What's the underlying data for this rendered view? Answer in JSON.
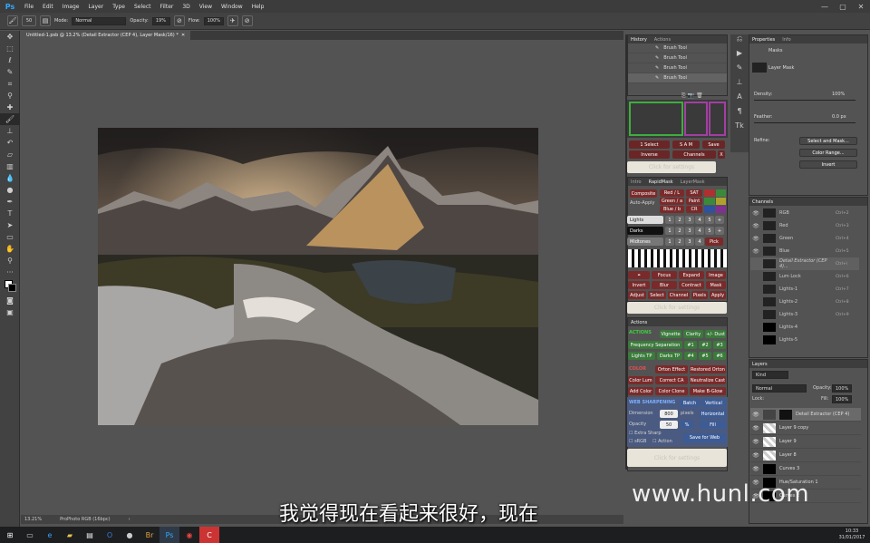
{
  "menubar": {
    "app_icon": "Ps",
    "items": [
      "File",
      "Edit",
      "Image",
      "Layer",
      "Type",
      "Select",
      "Filter",
      "3D",
      "View",
      "Window",
      "Help"
    ],
    "window_controls": [
      "—",
      "▢",
      "✕"
    ]
  },
  "options": {
    "brush_size": "50",
    "mode_label": "Mode:",
    "mode_value": "Normal",
    "opacity_label": "Opacity:",
    "opacity_value": "19%",
    "flow_label": "Flow:",
    "flow_value": "100%"
  },
  "document": {
    "tab_title": "Untitled-1.psb @ 13.2% (Detail Extractor (CEP 4), Layer Mask/16) *",
    "zoom": "13.21%",
    "profile": "ProPhoto RGB (16bpc)"
  },
  "history": {
    "tabs": [
      "History",
      "Actions"
    ],
    "rows": [
      "Brush Tool",
      "Brush Tool",
      "Brush Tool",
      "Brush Tool"
    ]
  },
  "rapidmask": {
    "row1": [
      "1 Select",
      "S A M",
      "Save"
    ],
    "row2": [
      "Inverse",
      "Channels",
      "X"
    ],
    "settings": "Click for settings",
    "tabs": [
      "Intro",
      "RapidMask",
      "LayerMask"
    ],
    "composite": "Composite",
    "auto_apply": "Auto-Apply",
    "rgb": [
      "Red / L",
      "Green / a",
      "Blue / b"
    ],
    "right": [
      "SAT",
      "Paint",
      "CR"
    ],
    "lights": "Lights",
    "darks": "Darks",
    "midtones": "Midtones",
    "nums": [
      "1",
      "2",
      "3",
      "4",
      "5",
      "+"
    ],
    "pick": "Pick",
    "row_a": [
      "Focus",
      "Expand",
      "Image"
    ],
    "row_b": [
      "Invert",
      "Blur",
      "Contract",
      "Mask"
    ],
    "row_c": [
      "Adjust",
      "Select",
      "Channel",
      "Pixels",
      "Apply"
    ],
    "settings2": "Click for settings"
  },
  "actions_panel": {
    "title": "Actions",
    "actions_label": "ACTIONS",
    "a1": [
      "Vignette",
      "Clarity",
      "+/- Dust"
    ],
    "a2": [
      "Frequency Separation",
      "#1",
      "#2",
      "#3"
    ],
    "a3": [
      "Lights TP",
      "Darks TP",
      "#4",
      "#5",
      "#6"
    ],
    "color_label": "COLOR",
    "c1": [
      "Orton Effect",
      "Restored Orton"
    ],
    "c2": [
      "Color Lum",
      "Correct CA",
      "Neutralize Cast"
    ],
    "c3": [
      "Add Color",
      "Color Clone",
      "Make B-Glow"
    ],
    "web_label": "WEB SHARPENING",
    "w_batch": "Batch",
    "w_vertical": "Vertical",
    "dimension": "Dimension",
    "dim_val": "800",
    "pixels": "pixels",
    "horizontal": "Horizontal",
    "opacity": "Opacity",
    "op_val": "50",
    "pct": "%",
    "fill": "Fill",
    "extra_sharp": "Extra Sharp",
    "srgb": "sRGB",
    "action": "Action",
    "save_web": "Save for Web",
    "settings3": "Click for settings"
  },
  "properties": {
    "tabs": [
      "Properties",
      "Info"
    ],
    "masks": "Masks",
    "layer_mask": "Layer Mask",
    "density_label": "Density:",
    "density_value": "100%",
    "feather_label": "Feather:",
    "feather_value": "0.0 px",
    "refine_label": "Refine:",
    "btn_select_mask": "Select and Mask...",
    "btn_color_range": "Color Range...",
    "btn_invert": "Invert"
  },
  "channels": {
    "title": "Channels",
    "rows": [
      {
        "name": "RGB",
        "key": "Ctrl+2"
      },
      {
        "name": "Red",
        "key": "Ctrl+3"
      },
      {
        "name": "Green",
        "key": "Ctrl+4"
      },
      {
        "name": "Blue",
        "key": "Ctrl+5"
      },
      {
        "name": "Detail Extractor (CEP 4)...",
        "key": "Ctrl+\\"
      },
      {
        "name": "Lum Lock",
        "key": "Ctrl+6"
      },
      {
        "name": "Lights-1",
        "key": "Ctrl+7"
      },
      {
        "name": "Lights-2",
        "key": "Ctrl+8"
      },
      {
        "name": "Lights-3",
        "key": "Ctrl+9"
      },
      {
        "name": "Lights-4",
        "key": ""
      },
      {
        "name": "Lights-5",
        "key": ""
      }
    ]
  },
  "layers": {
    "title": "Layers",
    "kind": "Kind",
    "blend": "Normal",
    "opacity_label": "Opacity:",
    "opacity_value": "100%",
    "lock_label": "Lock:",
    "fill_label": "Fill:",
    "fill_value": "100%",
    "rows": [
      "Detail Extractor (CEP 4)",
      "Layer 9 copy",
      "Layer 9",
      "Layer 8",
      "Curves 3",
      "Hue/Saturation 1",
      "Curves 2"
    ]
  },
  "taskbar": {
    "time": "10:33",
    "date": "31/01/2017"
  },
  "overlay": {
    "subtitle": "我觉得现在看起来很好，现在",
    "watermark": "www.hunl.com"
  }
}
